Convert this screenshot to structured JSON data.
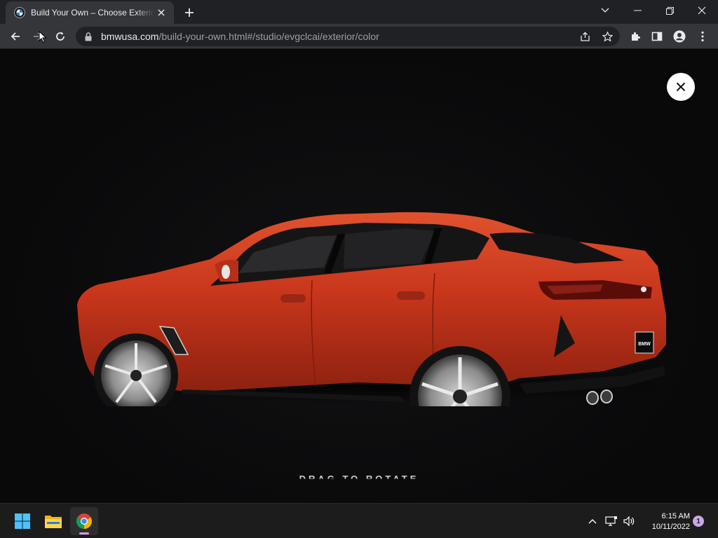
{
  "browser": {
    "tab": {
      "title": "Build Your Own – Choose Exterior Color"
    },
    "url": {
      "host": "bmwusa.com",
      "path": "/build-your-own.html#/studio/evgclcai/exterior/color"
    }
  },
  "page": {
    "drag_hint": "← DRAG TO ROTATE →",
    "car_color": "#c8361c"
  },
  "taskbar": {
    "time": "6:15 AM",
    "date": "10/11/2022",
    "notification_count": "1"
  },
  "colors": {
    "accent_chrome_active": "#d39ae6",
    "car_body": "#c8361c"
  }
}
